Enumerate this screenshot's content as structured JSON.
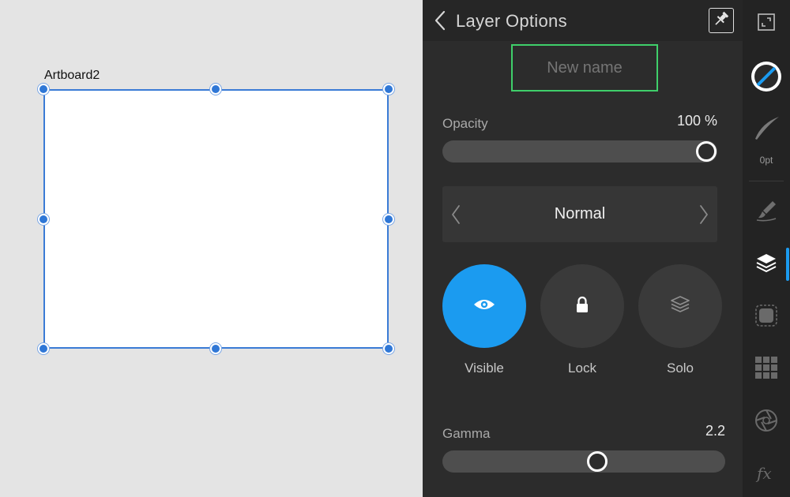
{
  "canvas": {
    "artboard_name": "Artboard2"
  },
  "panel": {
    "title": "Layer Options",
    "name_field": {
      "value": "",
      "placeholder": "New name"
    },
    "opacity": {
      "label": "Opacity",
      "value_text": "100 %",
      "value": 1.0
    },
    "blend_mode": {
      "selected": "Normal"
    },
    "toggles": [
      {
        "label": "Visible",
        "icon": "eye-icon",
        "active": true
      },
      {
        "label": "Lock",
        "icon": "lock-icon",
        "active": false
      },
      {
        "label": "Solo",
        "icon": "layers-icon",
        "active": false
      }
    ],
    "gamma": {
      "label": "Gamma",
      "value_text": "2.2",
      "value": 2.2
    }
  },
  "toolstrip": {
    "stroke_width": "0pt",
    "active_tool": "layers"
  },
  "colors": {
    "accent": "#1b9bf0",
    "focus_outline": "#3fcf6a",
    "selection": "#2f77d6"
  }
}
